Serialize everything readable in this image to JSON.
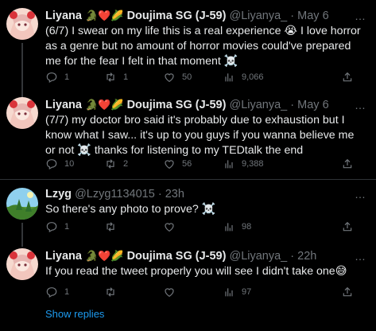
{
  "tweets": [
    {
      "name": "Liyana",
      "emojis": "🐊❤️🌽",
      "name2": "Doujima SG (J-59)",
      "handle": "@Liyanya_",
      "sep": "·",
      "time": "May 6",
      "text": "(6/7) I swear on my life this is a real experience 😭 I love horror as a genre but no amount of horror movies could've prepared me for the fear I felt in that moment ☠️",
      "replies": "1",
      "retweets": "1",
      "likes": "50",
      "views": "9,066"
    },
    {
      "name": "Liyana",
      "emojis": "🐊❤️🌽",
      "name2": "Doujima SG (J-59)",
      "handle": "@Liyanya_",
      "sep": "·",
      "time": "May 6",
      "text": "(7/7) my doctor bro said it's probably due to exhaustion but I know what I saw... it's up to you guys if you wanna believe me or not ☠️ thanks for listening to my TEDtalk the end",
      "replies": "10",
      "retweets": "2",
      "likes": "56",
      "views": "9,388"
    },
    {
      "name": "Lzyg",
      "emojis": "",
      "name2": "",
      "handle": "@Lzyg1134015",
      "sep": "·",
      "time": "23h",
      "text": "So there's any photo to prove? ☠️",
      "replies": "1",
      "retweets": "",
      "likes": "",
      "views": "98"
    },
    {
      "name": "Liyana",
      "emojis": "🐊❤️🌽",
      "name2": "Doujima SG (J-59)",
      "handle": "@Liyanya_",
      "sep": "·",
      "time": "22h",
      "text": "If you read the tweet properly you will see I didn't take one😅",
      "replies": "1",
      "retweets": "",
      "likes": "",
      "views": "97"
    }
  ],
  "show_replies": "Show replies",
  "more_icon": "…",
  "colors": {
    "background": "#000000",
    "text": "#e7e9ea",
    "muted": "#71767b",
    "link": "#1d9bf0",
    "divider": "#2f3336"
  }
}
